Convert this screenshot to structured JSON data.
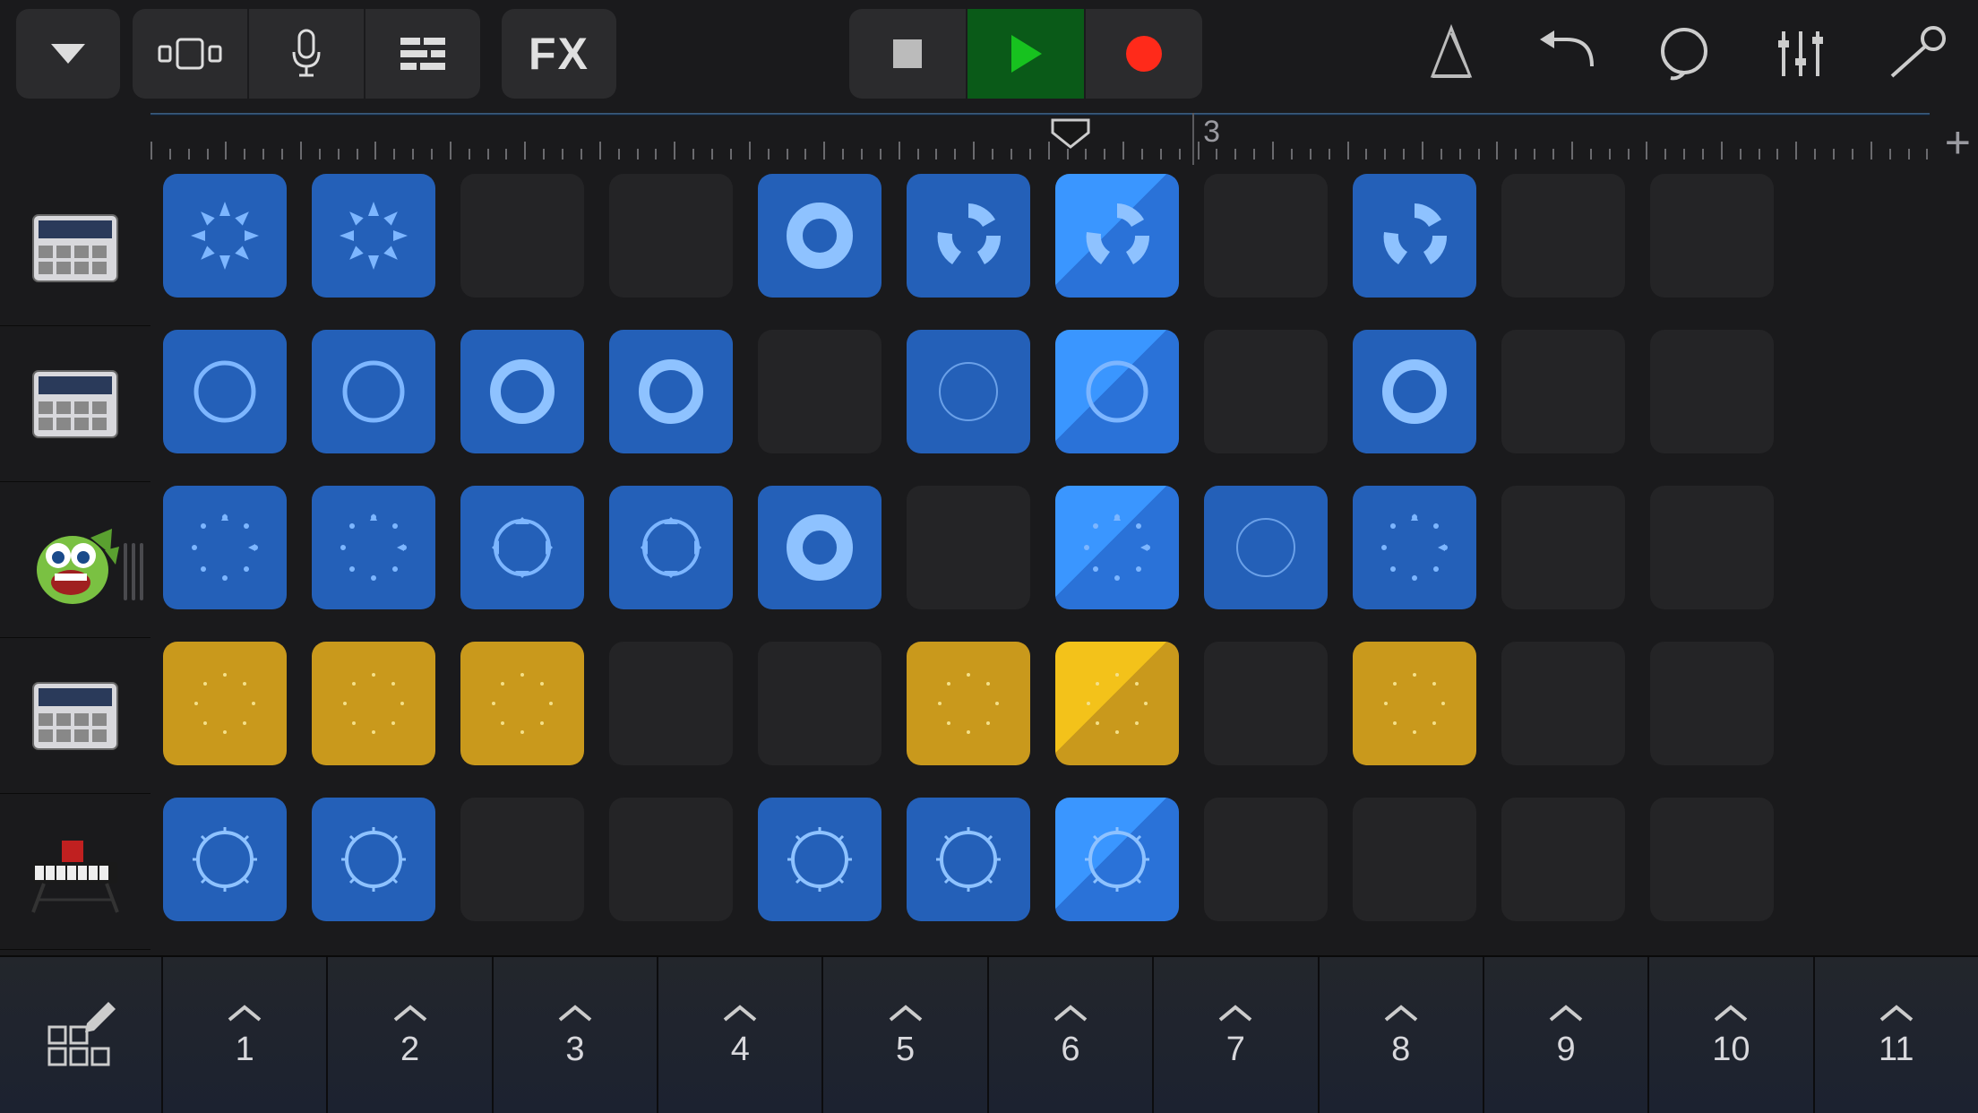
{
  "toolbar": {
    "fx_label": "FX"
  },
  "timeline": {
    "playhead_position_pct": 49.5,
    "bar_labels": [
      {
        "num": "3",
        "pct": 58.0
      }
    ]
  },
  "tracks": [
    {
      "icon": "drum-machine"
    },
    {
      "icon": "drum-machine"
    },
    {
      "icon": "monster"
    },
    {
      "icon": "drum-machine"
    },
    {
      "icon": "keyboard"
    }
  ],
  "columns": [
    "1",
    "2",
    "3",
    "4",
    "5",
    "6",
    "7",
    "8",
    "9",
    "10",
    "11"
  ],
  "grid": [
    [
      {
        "t": "blue",
        "w": "burst"
      },
      {
        "t": "blue",
        "w": "burst"
      },
      {
        "t": "empty"
      },
      {
        "t": "empty"
      },
      {
        "t": "blue",
        "w": "ring-thick"
      },
      {
        "t": "blue",
        "w": "segments"
      },
      {
        "t": "blue-active",
        "w": "segments"
      },
      {
        "t": "empty"
      },
      {
        "t": "blue",
        "w": "segments"
      },
      {
        "t": "empty"
      },
      {
        "t": "empty"
      }
    ],
    [
      {
        "t": "blue",
        "w": "ring"
      },
      {
        "t": "blue",
        "w": "ring"
      },
      {
        "t": "blue",
        "w": "ring-bold"
      },
      {
        "t": "blue",
        "w": "ring-bold"
      },
      {
        "t": "empty"
      },
      {
        "t": "blue",
        "w": "ring-thin"
      },
      {
        "t": "blue-active",
        "w": "ring"
      },
      {
        "t": "empty"
      },
      {
        "t": "blue",
        "w": "ring-bold"
      },
      {
        "t": "empty"
      },
      {
        "t": "empty"
      }
    ],
    [
      {
        "t": "blue",
        "w": "dots"
      },
      {
        "t": "blue",
        "w": "dots"
      },
      {
        "t": "blue",
        "w": "arrows"
      },
      {
        "t": "blue",
        "w": "arrows"
      },
      {
        "t": "blue",
        "w": "ring-thick"
      },
      {
        "t": "empty"
      },
      {
        "t": "blue-active",
        "w": "dots"
      },
      {
        "t": "blue",
        "w": "ring-thin"
      },
      {
        "t": "blue",
        "w": "dots"
      },
      {
        "t": "empty"
      },
      {
        "t": "empty"
      }
    ],
    [
      {
        "t": "yellow",
        "w": "sparse"
      },
      {
        "t": "yellow",
        "w": "sparse"
      },
      {
        "t": "yellow",
        "w": "sparse"
      },
      {
        "t": "empty"
      },
      {
        "t": "empty"
      },
      {
        "t": "yellow",
        "w": "sparse"
      },
      {
        "t": "yellow-active",
        "w": "sparse"
      },
      {
        "t": "empty"
      },
      {
        "t": "yellow",
        "w": "sparse"
      },
      {
        "t": "empty"
      },
      {
        "t": "empty"
      }
    ],
    [
      {
        "t": "blue",
        "w": "spiky"
      },
      {
        "t": "blue",
        "w": "spiky"
      },
      {
        "t": "empty"
      },
      {
        "t": "empty"
      },
      {
        "t": "blue",
        "w": "spiky"
      },
      {
        "t": "blue",
        "w": "spiky"
      },
      {
        "t": "blue-active",
        "w": "spiky"
      },
      {
        "t": "empty"
      },
      {
        "t": "empty"
      },
      {
        "t": "empty"
      },
      {
        "t": "empty"
      }
    ]
  ]
}
